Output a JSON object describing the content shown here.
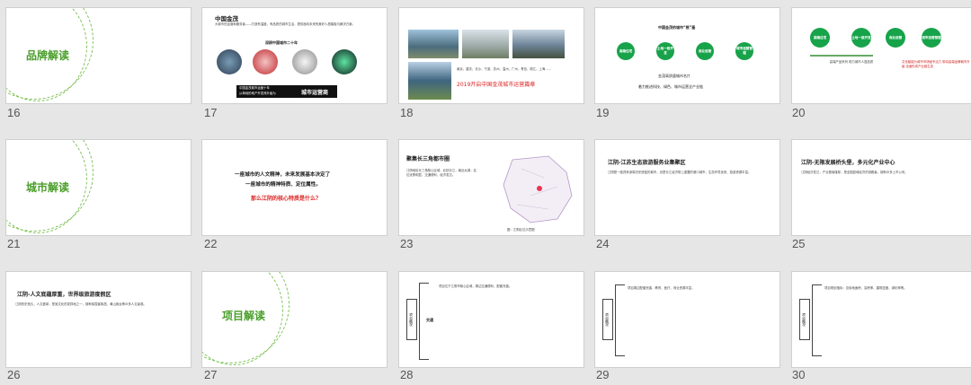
{
  "slide_numbers": [
    "16",
    "17",
    "18",
    "19",
    "20",
    "21",
    "22",
    "23",
    "24",
    "25",
    "26",
    "27",
    "28",
    "29",
    "30"
  ],
  "s16": {
    "title": "品牌解读"
  },
  "s17": {
    "title": "中国金茂",
    "body": "大城市的运营和服务者——打造有温度、有品质的城市生活，提供面向未来的美好人居模板与解决方案。",
    "subtitle": "深耕中国城市二十年",
    "caption_small": "中国金茂城市运营十年",
    "caption_main": "城市运营商",
    "caption_prefix": "从单纯的地产开发商升级为"
  },
  "s18": {
    "body": "南京、重庆、长沙、宁波、苏州、温州、广州、青岛、丽江、上海……",
    "highlight": "2019开启中国金茂城市运营篇章"
  },
  "s19": {
    "title": "中国金茂的城市“根”基",
    "circles": [
      "高端住宅",
      "土地一级开发",
      "商业运营",
      "城市运营管理"
    ],
    "mid": "金茂高质量城市名片",
    "bottom": "着力推进科技、绿色、城市运营全产业链"
  },
  "s20": {
    "circles": [
      "高端住宅",
      "土地一级开发",
      "商业运营",
      "城市运营管理"
    ],
    "left_note": "高端产品系列 助力城市人居品质",
    "right_note": "文化赋能为城市市场赋予活力 带动高端品牌城市升级 全面形成产业链生态"
  },
  "s21": {
    "title": "城市解读"
  },
  "s22": {
    "line1": "一座城市的人文精神，未来发展基本决定了",
    "line2": "一座城市的精神特质、定位属性。",
    "question": "那么江阴的核心特质是什么？"
  },
  "s23": {
    "title": "聚集长三角都市圈",
    "body": "江阴地处长三角核心区域，北枕长江，南近太湖，区位优势明显，交通便利，经济发达。",
    "caption": "图：江阴区位示意图"
  },
  "s24": {
    "title": "江阴-江苏生态旅游服务业集聚区",
    "body": "江阴是一座具有深厚历史底蕴的城市，也是长江经济带上重要的港口城市，生态环境优良，旅游资源丰富。"
  },
  "s25": {
    "title": "江阴-无限发展桥头堡，多元化产业中心",
    "body": "江阴经济发达，产业基础雄厚，是全国县域经济的领跑者，拥有众多上市公司。"
  },
  "s26": {
    "title": "江阴-人文底蕴厚重，世界级旅游度假区",
    "body": "江阴历史悠久，人文荟萃，是吴文化的发祥地之一，拥有徐霞客故居、黄山炮台等众多人文景观。"
  },
  "s27": {
    "title": "项目解读"
  },
  "s28": {
    "label": "项目概况",
    "item": "交通",
    "body": "项目位于江阴市核心区域，周边交通便利，配套完善。"
  },
  "s29": {
    "label": "项目概况",
    "body": "项目周边配套完善，教育、医疗、商业资源丰富。"
  },
  "s30": {
    "label": "项目概况",
    "body": "项目规划指标：总用地面积、容积率、建筑密度、绿化率等。"
  }
}
